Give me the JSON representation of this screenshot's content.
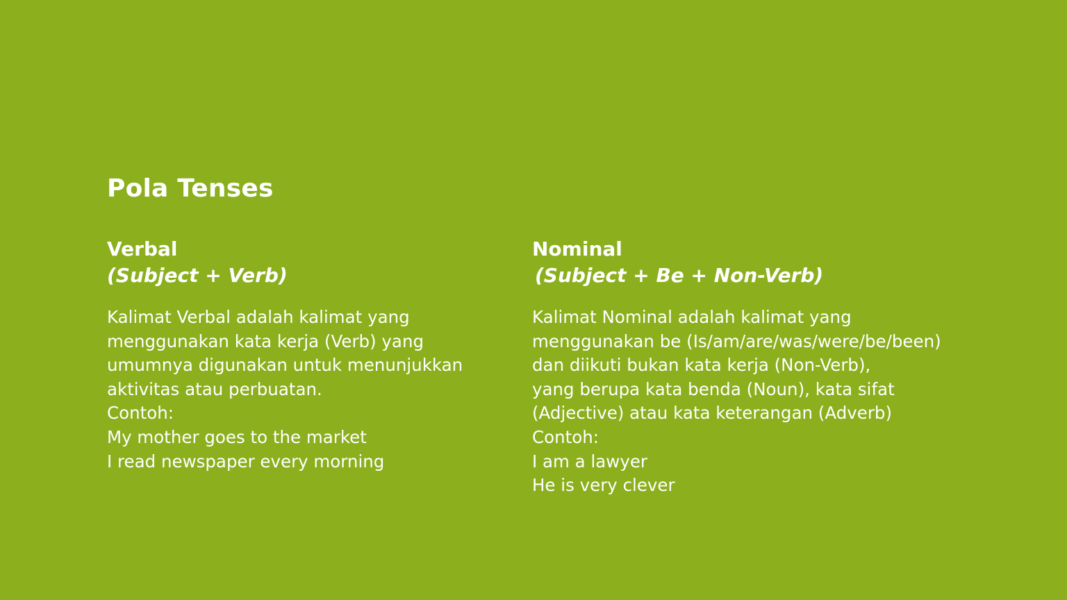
{
  "slide": {
    "title": "Pola Tenses",
    "background_color": "#8caf1e",
    "text_color": "#ffffff"
  },
  "verbal": {
    "heading": "Verbal",
    "pattern": "(Subject + Verb)",
    "lines": [
      "Kalimat Verbal adalah kalimat yang",
      "menggunakan kata kerja (Verb) yang",
      "umumnya digunakan untuk menunjukkan",
      "aktivitas atau perbuatan.",
      "Contoh:",
      "My mother goes to the market",
      "I read newspaper every morning"
    ]
  },
  "nominal": {
    "heading": "Nominal",
    "pattern": "(Subject + Be + Non-Verb)",
    "lines": [
      "Kalimat Nominal adalah kalimat yang",
      "menggunakan be (Is/am/are/was/were/be/been)",
      "dan diikuti bukan kata kerja (Non-Verb),",
      "yang berupa kata benda (Noun), kata sifat",
      "(Adjective) atau kata keterangan (Adverb)",
      "Contoh:",
      "I am a lawyer",
      "He is very clever"
    ]
  }
}
